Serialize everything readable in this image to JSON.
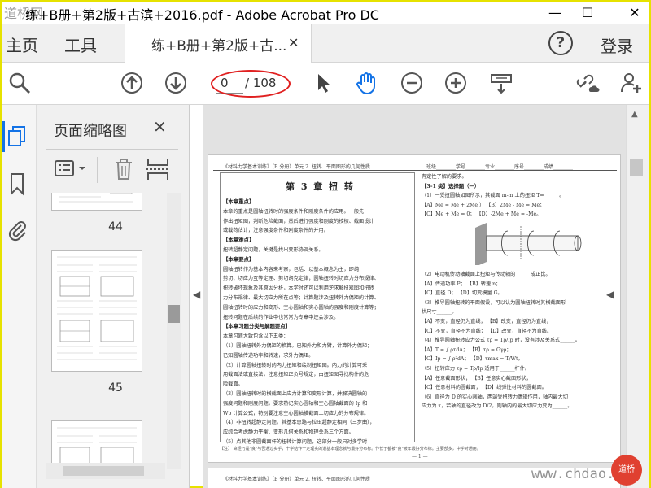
{
  "window": {
    "title": "练+B册+第2版+古滨+2016.pdf - Adobe Acrobat Pro DC",
    "corner_logo": "道桥网",
    "controls": {
      "minimize": "—",
      "maximize": "☐",
      "close": "✕"
    }
  },
  "tabbar": {
    "home": "主页",
    "tools": "工具",
    "doc_tab": "练+B册+第2版+古...",
    "doc_tab_close": "✕",
    "help": "?",
    "signin": "登录"
  },
  "toolbar": {
    "page_current": "0",
    "page_total": "/ 108",
    "icons": [
      "zoom-icon",
      "page-up-icon",
      "page-down-icon",
      "select-cursor-icon",
      "hand-tool-icon",
      "zoom-out-icon",
      "zoom-in-icon",
      "scroll-mode-icon",
      "link-cloud-icon",
      "add-user-icon"
    ],
    "highlight_color": "#e02020",
    "active_color": "#1473e6"
  },
  "thumbnails": {
    "title": "页面缩略图",
    "close": "✕",
    "pages": [
      {
        "number": "44"
      },
      {
        "number": "45"
      },
      {
        "number": ""
      }
    ]
  },
  "document": {
    "header_left": "《材料力学基本训练》（B 分册）单元 2. 扭转、平面图形的几何性质",
    "header_right": "班级________学号________专业________序号________成绩________",
    "chapter_title": "第 3 章   扭   转",
    "left_sections": [
      {
        "kind": "sec",
        "text": "【本章重点】"
      },
      {
        "kind": "txt",
        "text": "    本章的重点是圆轴扭转时的强度条件和刚度条件的应用。一般先"
      },
      {
        "kind": "txt",
        "text": "作出扭矩图，判断危险截面，然后进行强度和刚度的校核、截面设计"
      },
      {
        "kind": "txt",
        "text": "或载荷估计，注意强度条件和刚度条件的并用。"
      },
      {
        "kind": "sec",
        "text": "【本章难点】"
      },
      {
        "kind": "txt",
        "text": "    扭转超静定问题，关键是找出变形协调关系。"
      },
      {
        "kind": "sec",
        "text": "【本章要点】"
      },
      {
        "kind": "txt",
        "text": "    圆轴扭转作为基本内容来考察，包括：以基本概念为主，即纯"
      },
      {
        "kind": "txt",
        "text": "剪切、切应力互等定理、剪切胡克定律；圆轴扭转时切应力分布规律、"
      },
      {
        "kind": "txt",
        "text": "扭转破坏现象及其原因分析，本学时还可以利用逆求解扭矩图和扭转"
      },
      {
        "kind": "txt",
        "text": "力分布规律、最大切应力所在点等；计算题涉及扭转外力偶矩的计算、"
      },
      {
        "kind": "txt",
        "text": "圆轴扭转时的应力和变形、空心圆轴和实心圆轴的强度和刚度计算等；"
      },
      {
        "kind": "txt",
        "text": "扭转问题在后续的作业中也常常为专章中还会涉及。"
      },
      {
        "kind": "sec",
        "text": "【本章习题分类与解题要点】"
      },
      {
        "kind": "txt",
        "text": "本章习题大致包含以下五类："
      },
      {
        "kind": "txt",
        "text": "    （1）圆轴扭转外力偶矩的换算。已知外力和力臂，计算外力偶矩；"
      },
      {
        "kind": "txt",
        "text": "已知圆轴传递功率和转速，求外力偶矩。"
      },
      {
        "kind": "txt",
        "text": "    （2）计算圆轴扭转时的内力扭矩和绘制扭矩图。内力的计算可采"
      },
      {
        "kind": "txt",
        "text": "用截面法或直接法，注意扭矩正负号规定，由扭矩图寻找构件的危"
      },
      {
        "kind": "txt",
        "text": "险截面。"
      },
      {
        "kind": "txt",
        "text": "    （3）圆轴扭转时的横截面上应力计算和变形计算，并解决圆轴的"
      },
      {
        "kind": "txt",
        "text": "强度问题和刚度问题。要求熟记实心圆轴和空心圆轴截面的 Ip 和"
      },
      {
        "kind": "txt",
        "text": "Wp 计算公式，特别要注意空心圆轴横截面上切应力的分布规律。"
      },
      {
        "kind": "txt",
        "text": "    （4）非扭转超静定问题。其基本思路与拉压超静定相同（三步曲），"
      },
      {
        "kind": "txt",
        "text": "应综合考虑静力平衡、变形几何关系和物理关系三个方面。"
      },
      {
        "kind": "txt",
        "text": "    （5）点其他非圆截面杆的扭转计算问题，这部分一般只对多学时"
      }
    ],
    "right_sections": [
      {
        "kind": "txt",
        "text": "有定性了解的要求。"
      },
      {
        "kind": "sec",
        "text": "【3-1 类】选择题（一）"
      },
      {
        "kind": "txt",
        "text": "（1）一受扭圆轴如图所示，其截面 m-m 上的扭矩 T=______。"
      },
      {
        "kind": "txt",
        "text": "【A】Me = Me + 2Me ）       【B】2Me - Me = Me；"
      },
      {
        "kind": "txt",
        "text": "【C】Me + Me = 0；           【D】-2Me + Me = -Me。"
      },
      {
        "kind": "fig",
        "text": ""
      },
      {
        "kind": "txt",
        "text": "（2）电动机传动轴截面上扭矩与传动轴的______成正比。"
      },
      {
        "kind": "txt",
        "text": "【A】传递功率 P；            【B】转速 n；"
      },
      {
        "kind": "txt",
        "text": "【C】直径 D；                【D】切变模量 G。"
      },
      {
        "kind": "txt",
        "text": "（3）推导圆轴扭转的平面假设，可以认为圆轴扭转时其横截面形"
      },
      {
        "kind": "txt",
        "text": "状尺寸______。"
      },
      {
        "kind": "txt",
        "text": "【A】不变，直径仍为直线；   【B】改变，直径仍为直线；"
      },
      {
        "kind": "txt",
        "text": "【C】不变，直径不为直线；   【D】改变，直径不为直线。"
      },
      {
        "kind": "txt",
        "text": "（4）推导圆轴扭转应力公式 τρ = Tρ/Ip 时，没有涉及关系式______。"
      },
      {
        "kind": "txt",
        "text": "【A】T = ∫ ρτdA；            【B】τρ = Gγρ；"
      },
      {
        "kind": "txt",
        "text": "【C】Ip = ∫ ρ²dA；           【D】τmax = T/Wt。"
      },
      {
        "kind": "txt",
        "text": "（5）扭转应力 τρ = Tρ/Ip 适用于______杆件。"
      },
      {
        "kind": "txt",
        "text": "【A】任意截面形状；         【B】任意实心截面形状；"
      },
      {
        "kind": "txt",
        "text": "【C】任意材料的圆截面；     【D】线弹性材料的圆截面。"
      },
      {
        "kind": "txt",
        "text": "（6）直径为 D 的实心圆轴，两端受扭转力偶矩作用，轴内最大切"
      },
      {
        "kind": "txt",
        "text": "应力为 τ，若轴的直径改为 D/2，则轴内的最大切应力变为______。"
      }
    ],
    "footnote": "【注】 算经乃是\"良\"与吾通过实乎，十学结作一定理实的道基本理念就与最好分布标。作长于都被\"良\"被年最好分布标。主要部多，中学对通用。",
    "page_number": "— 1 —",
    "next_header": "《材料力学基本训练》（B 分册）单元 2. 扭转、平面图形的几何性质"
  },
  "watermark": {
    "text": "www.chdao.com",
    "logo": "道桥"
  }
}
